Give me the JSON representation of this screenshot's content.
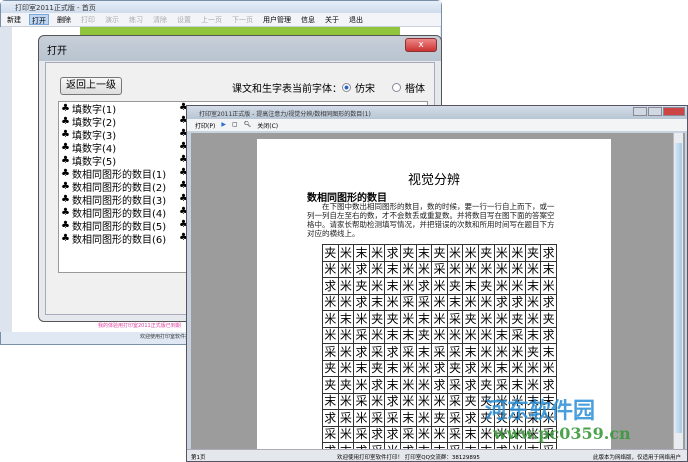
{
  "main_window": {
    "title": "打印室2011正式版 - 首页",
    "toolbar": [
      {
        "label": "新建",
        "enabled": true
      },
      {
        "label": "打开",
        "enabled": true,
        "selected": true
      },
      {
        "label": "删除",
        "enabled": true
      },
      {
        "label": "打印",
        "enabled": false
      },
      {
        "label": "演示",
        "enabled": false
      },
      {
        "label": "练习",
        "enabled": false
      },
      {
        "label": "清除",
        "enabled": false
      },
      {
        "label": "设置",
        "enabled": false
      },
      {
        "label": "上一页",
        "enabled": false
      },
      {
        "label": "下一页",
        "enabled": false
      },
      {
        "label": "用户管理",
        "enabled": true
      },
      {
        "label": "信息",
        "enabled": true
      },
      {
        "label": "关于",
        "enabled": true
      },
      {
        "label": "退出",
        "enabled": true
      }
    ],
    "status": "欢迎使用打印室软件打印！",
    "notice": "我的体验用打印室2011正式版已到期"
  },
  "dialog": {
    "title": "打开",
    "close": "x",
    "back_button": "返回上一级",
    "font_label": "课文和生字表当前字体：",
    "font_options": [
      {
        "label": "仿宋",
        "checked": true
      },
      {
        "label": "楷体",
        "checked": false
      }
    ],
    "items": [
      "填数字(1)",
      "填数字(2)",
      "填数字(3)",
      "填数字(4)",
      "填数字(5)",
      "数相同图形的数目(1)",
      "数相同图形的数目(2)",
      "数相同图形的数目(3)",
      "数相同图形的数目(4)",
      "数相同图形的数目(5)",
      "数相同图形的数目(6)"
    ]
  },
  "viewer": {
    "title": "打印室2011正式版 - 提高注意力/视觉分辨/数相同图形的数目(1)",
    "print": "打印(P)",
    "close": "关闭(C)",
    "doc": {
      "title": "视觉分辨",
      "subtitle": "数相同图形的数目",
      "instructions": "在下图中数出相同图形的数目，数的时候，要一行一行自上而下，或一列一列自左至右的数，才不会数丢或重复数。并将数目写在图下面的答案空格中。请家长帮助检测填写情况，并把错误的次数和所用时间写在题目下方对应的横线上。",
      "grid": [
        "夹米末米求夹末夹米米夹米米夹求",
        "米米求米末米米采米米米米米米末",
        "求米夹米末米求米夹末夹米米末米",
        "米米求末米采采米末米米求求米求",
        "米末米夹夹米末米采夹米米夹米夹",
        "米米采米末末夹米米米米末采末求",
        "采米求采求采末采采末米米米夹末",
        "夹米末夹末米米求夹求米末米米米",
        "夹夹米求末米米求采求夹采末米求",
        "末米采米求米米米采夹夹米米末末",
        "求采米采采末米夹采求夹夹米采米",
        "采米采求求采米米采末米米米米采",
        "求末求采米求末末采末末求米末采"
      ]
    },
    "status": {
      "page": "第1页",
      "center": "欢迎使用打印室软件打印！ 打印室QQ交流群：38129895",
      "right": "此版本为网络版，仅适用于网络用户"
    }
  },
  "watermark": {
    "name": "河东软件园",
    "url": "www.pc0359.cn"
  }
}
